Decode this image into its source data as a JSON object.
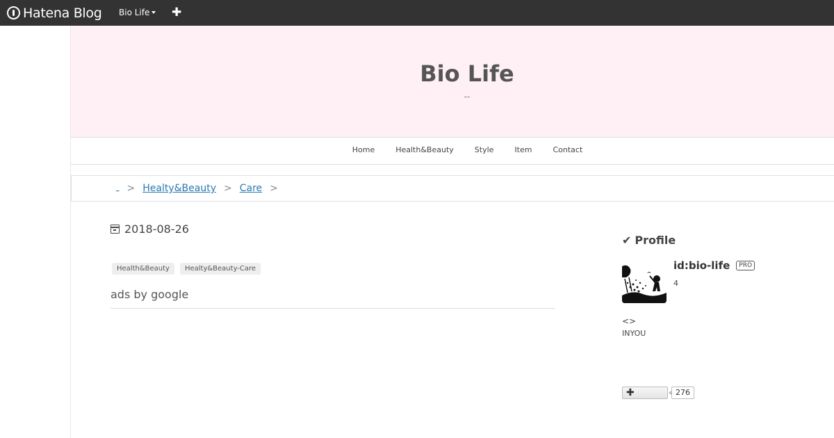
{
  "topbar": {
    "logo_text": "Hatena Blog",
    "blog_menu_label": "Bio Life",
    "add_label": "✚"
  },
  "header": {
    "title": "Bio Life",
    "description": "--"
  },
  "nav": {
    "items": [
      "Home",
      "Health&Beauty",
      "Style",
      "Item",
      "Contact"
    ]
  },
  "breadcrumb": {
    "items": [
      "_",
      "Healty&Beauty",
      "Care"
    ],
    "separator": ">"
  },
  "article": {
    "date": "2018-08-26",
    "tags": [
      "Health&Beauty",
      "Healty&Beauty-Care"
    ],
    "ads_label": "ads by google"
  },
  "sidebar": {
    "profile_heading": "Profile",
    "profile_id": "id:bio-life",
    "pro_badge": "PRO",
    "profile_count": "4",
    "brackets": "<>",
    "inyou": "INYOU",
    "bookmark_count": "276"
  },
  "colors": {
    "topbar": "#333333",
    "header_bg": "#fff0f5",
    "link": "#2a7ab0"
  }
}
